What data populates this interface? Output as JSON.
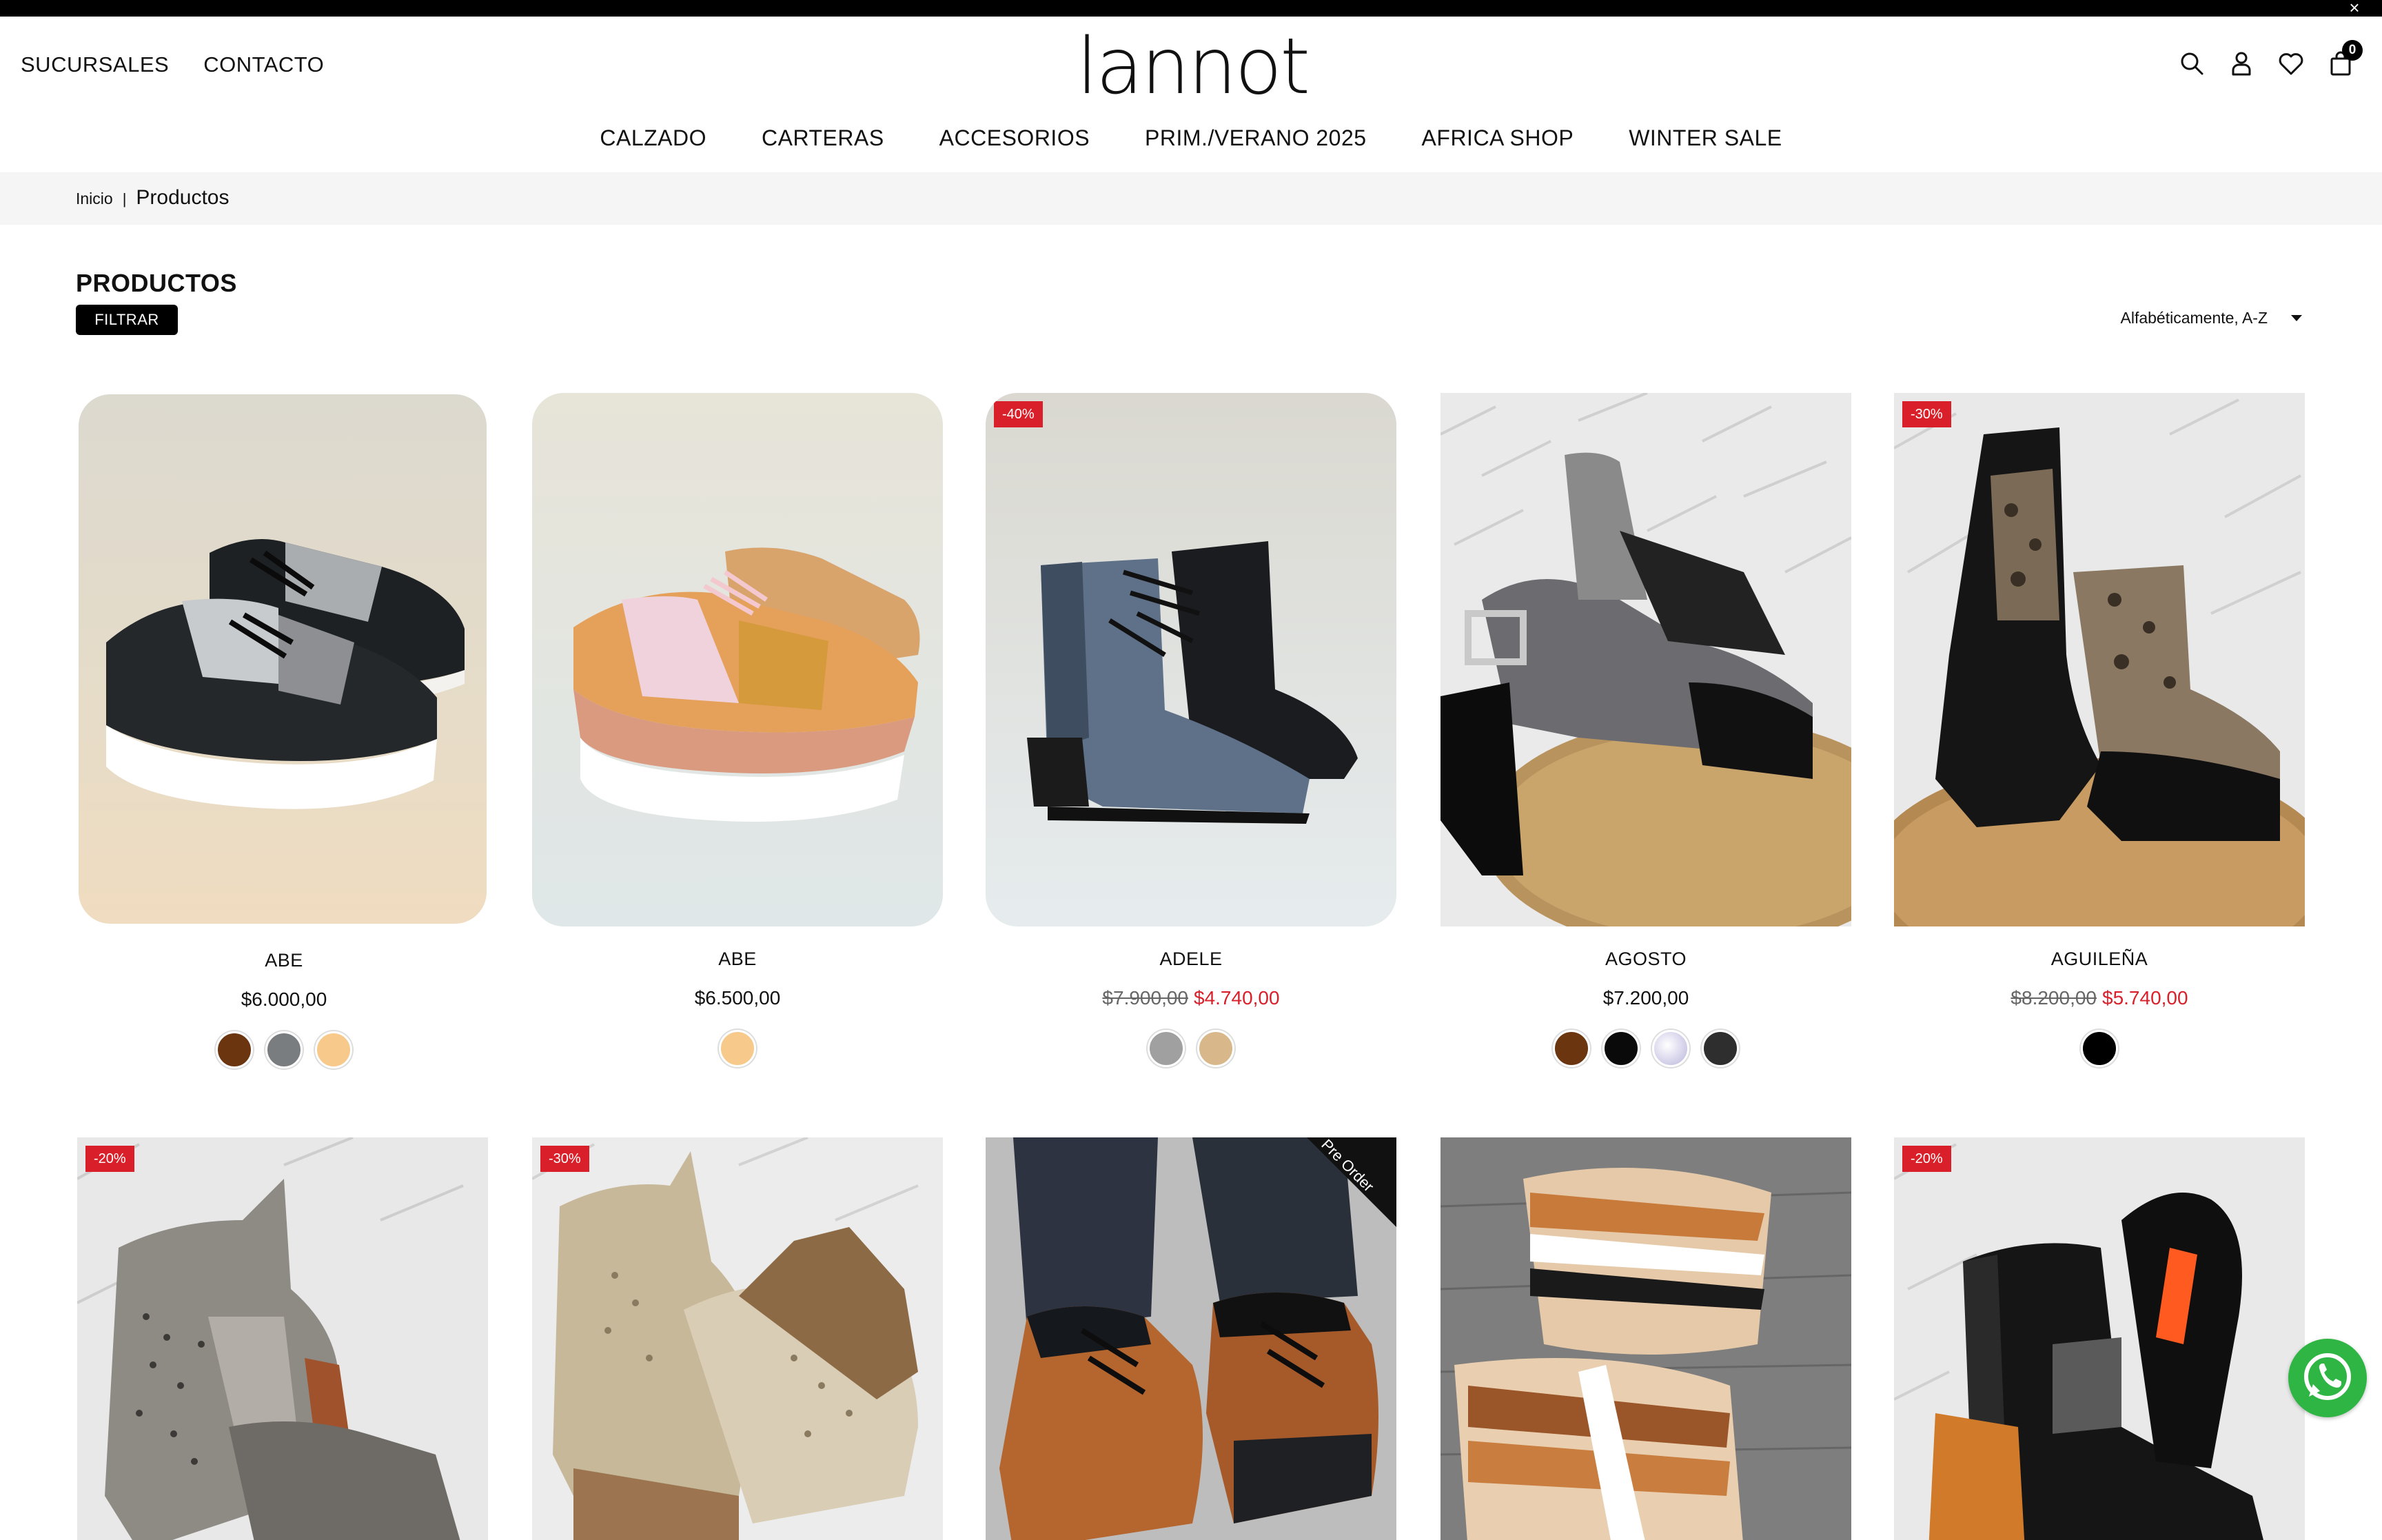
{
  "brand": {
    "logo_text": "lannot"
  },
  "header": {
    "left_links": [
      "SUCURSALES",
      "CONTACTO"
    ],
    "cart_count": "0"
  },
  "nav": [
    "CALZADO",
    "CARTERAS",
    "ACCESORIOS",
    "PRIM./VERANO 2025",
    "AFRICA SHOP",
    "WINTER SALE"
  ],
  "breadcrumb": {
    "home": "Inicio",
    "separator": "|",
    "current": "Productos"
  },
  "page": {
    "title": "PRODUCTOS",
    "filter_label": "FILTRAR",
    "sort_label": "Alfabéticamente, A-Z"
  },
  "colors": {
    "accent_sale": "#d9202a",
    "whatsapp": "#2fb544"
  },
  "products": [
    {
      "name": "ABE",
      "price": "$6.000,00",
      "old_price": "",
      "sale_price": "",
      "badge": "",
      "rounded": true,
      "swatches": [
        "#6b3510",
        "#7a7d80",
        "#f7c98a"
      ],
      "image": "silver-black-sneakers"
    },
    {
      "name": "ABE",
      "price": "$6.500,00",
      "old_price": "",
      "sale_price": "",
      "badge": "",
      "rounded": true,
      "swatches": [
        "#f7c98a"
      ],
      "image": "pink-mustard-sneakers"
    },
    {
      "name": "ADELE",
      "price": "",
      "old_price": "$7.900,00",
      "sale_price": "$4.740,00",
      "badge": "-40%",
      "rounded": true,
      "swatches": [
        "#a0a0a0",
        "#d8b88a"
      ],
      "image": "blue-suede-boot"
    },
    {
      "name": "AGOSTO",
      "price": "$7.200,00",
      "old_price": "",
      "sale_price": "",
      "badge": "",
      "rounded": false,
      "swatches": [
        "#6b3510",
        "#0a0a0a",
        "#c8c0e0",
        "#2e2e2e"
      ],
      "image": "metallic-sandal"
    },
    {
      "name": "AGUILEÑA",
      "price": "",
      "old_price": "$8.200,00",
      "sale_price": "$5.740,00",
      "badge": "-30%",
      "rounded": false,
      "swatches": [
        "#000000"
      ],
      "image": "leopard-ankle-boot"
    },
    {
      "name": "",
      "price": "",
      "old_price": "",
      "sale_price": "",
      "badge": "-20%",
      "rounded": false,
      "swatches": [],
      "image": "perforated-silver-boot"
    },
    {
      "name": "",
      "price": "",
      "old_price": "",
      "sale_price": "",
      "badge": "-30%",
      "rounded": false,
      "swatches": [],
      "image": "beige-perforated-boot"
    },
    {
      "name": "",
      "price": "",
      "old_price": "",
      "sale_price": "",
      "badge": "",
      "preorder": "Pre Order",
      "rounded": false,
      "swatches": [],
      "image": "tan-laced-sneaker"
    },
    {
      "name": "",
      "price": "",
      "old_price": "",
      "sale_price": "",
      "badge": "",
      "rounded": false,
      "swatches": [],
      "image": "strappy-brown-sandal"
    },
    {
      "name": "",
      "price": "",
      "old_price": "",
      "sale_price": "",
      "badge": "-20%",
      "rounded": false,
      "swatches": [],
      "image": "black-western-boot"
    }
  ]
}
